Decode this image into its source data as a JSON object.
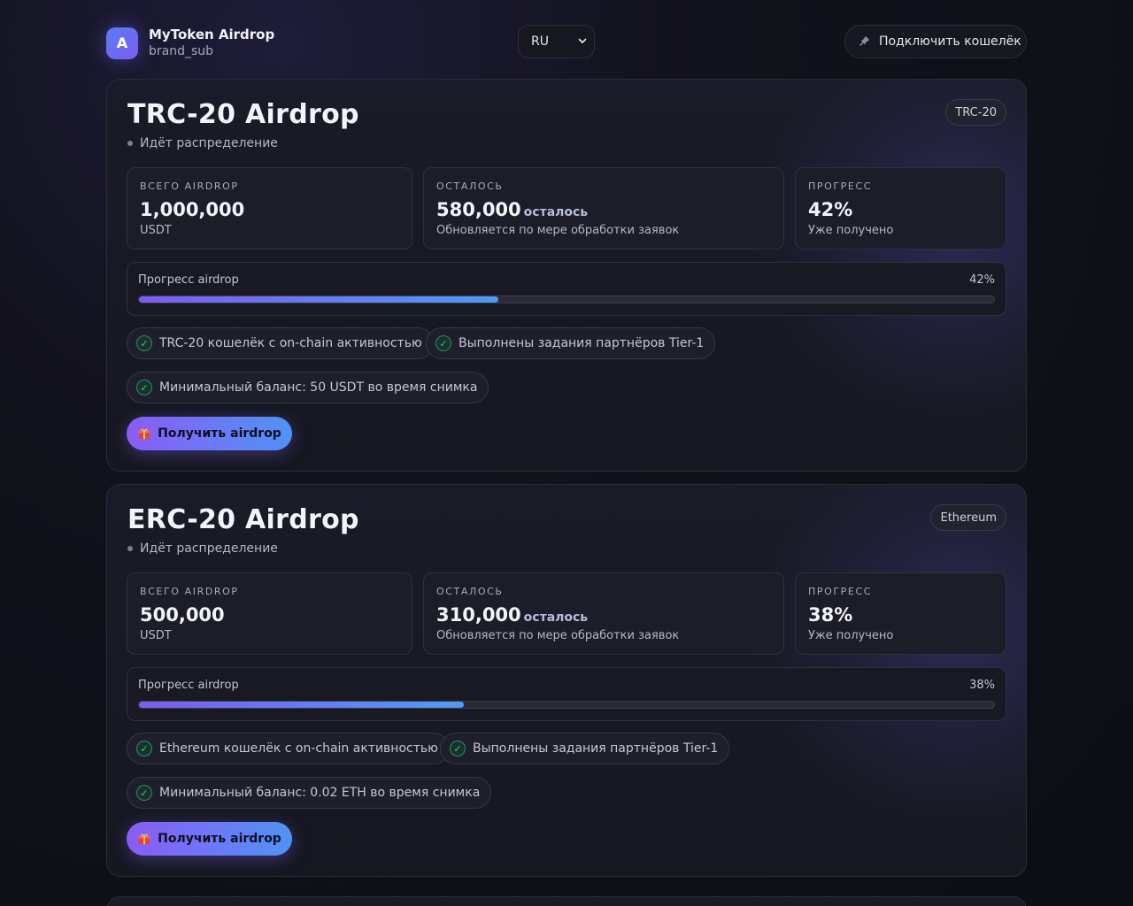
{
  "brand": {
    "logo_letter": "A",
    "name": "MyToken Airdrop",
    "sub": "brand_sub"
  },
  "language": {
    "selected": "RU"
  },
  "wallet": {
    "connect_label": "Подключить кошелёк"
  },
  "airdrops": [
    {
      "title": "TRC-20 Airdrop",
      "network": "TRC-20",
      "status": "Идёт распределение",
      "total": {
        "label": "ВСЕГО AIRDROP",
        "value": "1,000,000",
        "note": "USDT"
      },
      "remaining": {
        "label": "ОСТАЛОСЬ",
        "value": "580,000",
        "suffix": "осталось",
        "note": "Обновляется по мере обработки заявок"
      },
      "progress": {
        "label": "ПРОГРЕСС",
        "value": "42%",
        "note": "Уже получено"
      },
      "progress_bar": {
        "label": "Прогресс airdrop",
        "percent_text": "42%",
        "fraction": 0.42
      },
      "requirements": [
        "TRC-20 кошелёк с on-chain активностью",
        "Выполнены задания партнёров Tier-1",
        "Минимальный баланс: 50 USDT во время снимка"
      ],
      "claim_label": "Получить airdrop"
    },
    {
      "title": "ERC-20 Airdrop",
      "network": "Ethereum",
      "status": "Идёт распределение",
      "total": {
        "label": "ВСЕГО AIRDROP",
        "value": "500,000",
        "note": "USDT"
      },
      "remaining": {
        "label": "ОСТАЛОСЬ",
        "value": "310,000",
        "suffix": "осталось",
        "note": "Обновляется по мере обработки заявок"
      },
      "progress": {
        "label": "ПРОГРЕСС",
        "value": "38%",
        "note": "Уже получено"
      },
      "progress_bar": {
        "label": "Прогресс airdrop",
        "percent_text": "38%",
        "fraction": 0.38
      },
      "requirements": [
        "Ethereum кошелёк с on-chain активностью",
        "Выполнены задания партнёров Tier-1",
        "Минимальный баланс: 0.02 ETH во время снимка"
      ],
      "claim_label": "Получить airdrop"
    }
  ],
  "icons": {
    "check": "check-icon",
    "gift": "gift-icon",
    "plug": "plug-icon",
    "chevron": "chevron-down-icon"
  },
  "colors": {
    "accent_start": "#8b5cf6",
    "accent_end": "#4f93f5",
    "success": "#41c48d"
  }
}
